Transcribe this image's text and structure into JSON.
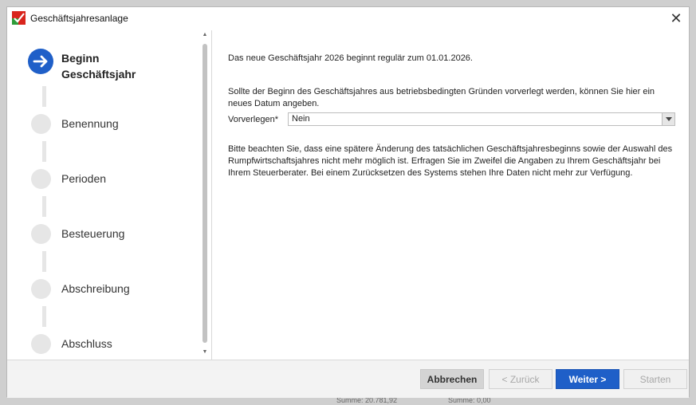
{
  "window": {
    "title": "Geschäftsjahresanlage",
    "close_symbol": "✕",
    "icons": {
      "app": "app-logo-icon",
      "close": "close-icon"
    },
    "colors": {
      "accent": "#1f5fc8",
      "inactive_step": "#e6e6e6",
      "footer_bg": "#f3f3f3"
    }
  },
  "steps": [
    {
      "label": "Beginn Geschäftsjahr",
      "label_line1": "Beginn",
      "label_line2": "Geschäftsjahr",
      "active": true
    },
    {
      "label": "Benennung",
      "active": false
    },
    {
      "label": "Perioden",
      "active": false
    },
    {
      "label": "Besteuerung",
      "active": false
    },
    {
      "label": "Abschreibung",
      "active": false
    },
    {
      "label": "Abschluss",
      "active": false
    }
  ],
  "content": {
    "intro": "Das neue Geschäftsjahr 2026 beginnt regulär zum 01.01.2026.",
    "info": "Sollte der Beginn des Geschäftsjahres aus betriebsbedingten Gründen vorverlegt werden, können Sie hier ein neues Datum angeben.",
    "field": {
      "label": "Vorverlegen*",
      "value": "Nein"
    },
    "note": "Bitte beachten Sie, dass eine spätere Änderung des tatsächlichen Geschäftsjahresbeginns sowie der Auswahl des Rumpfwirtschaftsjahres nicht mehr möglich ist. Erfragen Sie im Zweifel die Angaben zu Ihrem Geschäftsjahr bei Ihrem Steuerberater. Bei einem Zurücksetzen des Systems stehen Ihre Daten nicht mehr zur Verfügung."
  },
  "footer": {
    "cancel": "Abbrechen",
    "back": "< Zurück",
    "next": "Weiter >",
    "start": "Starten"
  },
  "background": {
    "left_sum": "Summe: 20.781,92",
    "right_sum": "Summe: 0,00"
  }
}
